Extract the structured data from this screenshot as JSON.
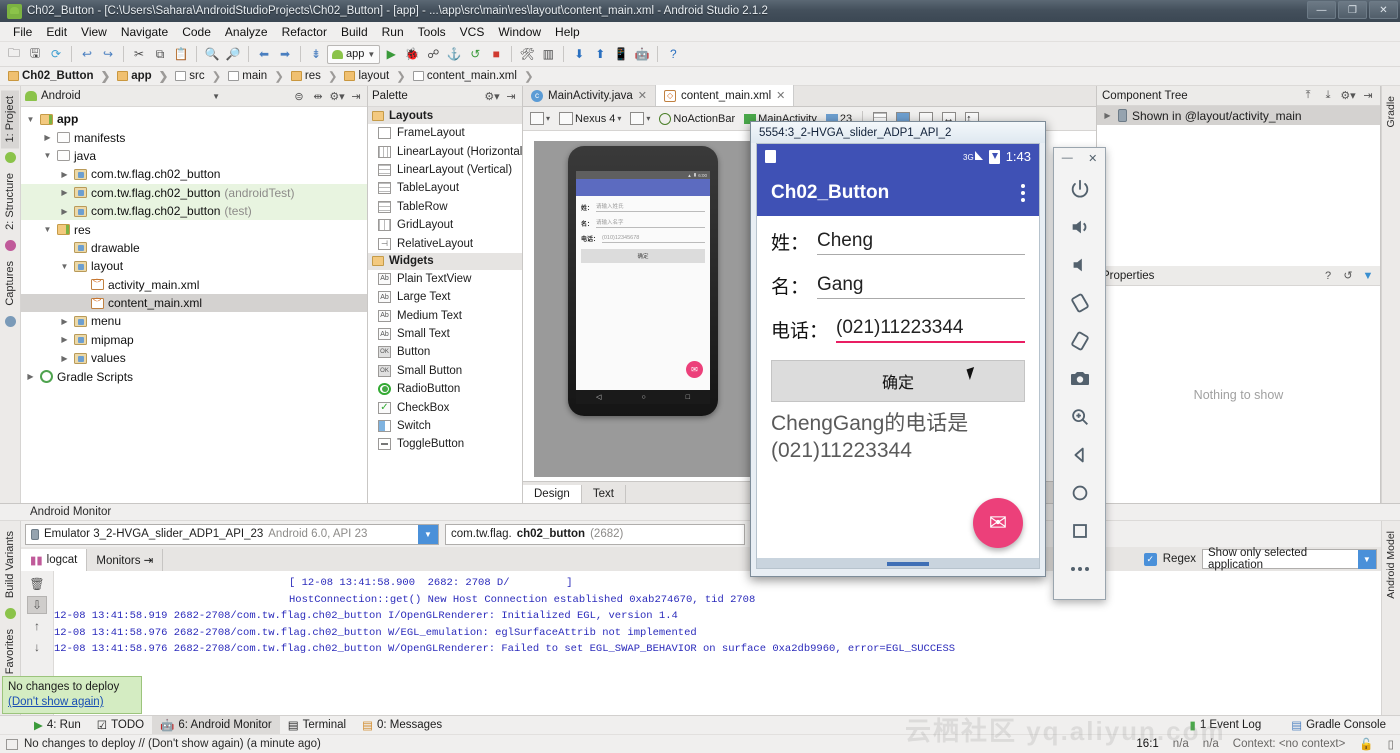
{
  "window": {
    "title": "Ch02_Button - [C:\\Users\\Sahara\\AndroidStudioProjects\\Ch02_Button] - [app] - ...\\app\\src\\main\\res\\layout\\content_main.xml - Android Studio 2.1.2",
    "minimize": "—",
    "maximize": "❐",
    "close": "✕"
  },
  "menu": [
    "File",
    "Edit",
    "View",
    "Navigate",
    "Code",
    "Analyze",
    "Refactor",
    "Build",
    "Run",
    "Tools",
    "VCS",
    "Window",
    "Help"
  ],
  "toolbar": {
    "app_label": "app"
  },
  "breadcrumb": [
    {
      "label": "Ch02_Button",
      "type": "folder",
      "bold": true
    },
    {
      "label": "app",
      "type": "folderb",
      "bold": true
    },
    {
      "label": "src",
      "type": "folderw",
      "bold": false
    },
    {
      "label": "main",
      "type": "folderw",
      "bold": false
    },
    {
      "label": "res",
      "type": "folderb",
      "bold": false
    },
    {
      "label": "layout",
      "type": "pkg",
      "bold": false
    },
    {
      "label": "content_main.xml",
      "type": "xml",
      "bold": false
    }
  ],
  "left_rail": [
    "1: Project",
    "2: Structure",
    "Captures"
  ],
  "left_rail_bottom": [
    "Build Variants",
    "Favorites"
  ],
  "right_rail": [
    "Gradle",
    "Android Model"
  ],
  "project": {
    "header_label": "Android",
    "tree": [
      {
        "indent": 0,
        "arrow": "▼",
        "icon": "folderb",
        "label": "app",
        "bold": true,
        "dim": "",
        "state": "none"
      },
      {
        "indent": 1,
        "arrow": "▶",
        "icon": "folderw",
        "label": "manifests",
        "bold": false,
        "dim": "",
        "state": "none"
      },
      {
        "indent": 1,
        "arrow": "▼",
        "icon": "folderw",
        "label": "java",
        "bold": false,
        "dim": "",
        "state": "none"
      },
      {
        "indent": 2,
        "arrow": "▶",
        "icon": "pkg",
        "label": "com.tw.flag.ch02_button",
        "bold": false,
        "dim": "",
        "state": "none"
      },
      {
        "indent": 2,
        "arrow": "▶",
        "icon": "pkg",
        "label": "com.tw.flag.ch02_button",
        "bold": false,
        "dim": "(androidTest)",
        "state": "test"
      },
      {
        "indent": 2,
        "arrow": "▶",
        "icon": "pkg",
        "label": "com.tw.flag.ch02_button",
        "bold": false,
        "dim": "(test)",
        "state": "test"
      },
      {
        "indent": 1,
        "arrow": "▼",
        "icon": "folderb",
        "label": "res",
        "bold": false,
        "dim": "",
        "state": "none"
      },
      {
        "indent": 2,
        "arrow": "",
        "icon": "pkg",
        "label": "drawable",
        "bold": false,
        "dim": "",
        "state": "none"
      },
      {
        "indent": 2,
        "arrow": "▼",
        "icon": "pkg",
        "label": "layout",
        "bold": false,
        "dim": "",
        "state": "none"
      },
      {
        "indent": 3,
        "arrow": "",
        "icon": "xml",
        "label": "activity_main.xml",
        "bold": false,
        "dim": "",
        "state": "none"
      },
      {
        "indent": 3,
        "arrow": "",
        "icon": "xml",
        "label": "content_main.xml",
        "bold": false,
        "dim": "",
        "state": "selected"
      },
      {
        "indent": 2,
        "arrow": "▶",
        "icon": "pkg",
        "label": "menu",
        "bold": false,
        "dim": "",
        "state": "none"
      },
      {
        "indent": 2,
        "arrow": "▶",
        "icon": "pkg",
        "label": "mipmap",
        "bold": false,
        "dim": "",
        "state": "none"
      },
      {
        "indent": 2,
        "arrow": "▶",
        "icon": "pkg",
        "label": "values",
        "bold": false,
        "dim": "",
        "state": "none"
      },
      {
        "indent": 0,
        "arrow": "▶",
        "icon": "gradle",
        "label": "Gradle Scripts",
        "bold": false,
        "dim": "",
        "state": "none"
      }
    ]
  },
  "palette": {
    "title": "Palette",
    "groups": [
      {
        "name": "Layouts",
        "items": [
          {
            "label": "FrameLayout",
            "icon": "frame"
          },
          {
            "label": "LinearLayout (Horizontal)",
            "icon": "linh"
          },
          {
            "label": "LinearLayout (Vertical)",
            "icon": "linv"
          },
          {
            "label": "TableLayout",
            "icon": "tbl"
          },
          {
            "label": "TableRow",
            "icon": "tbl"
          },
          {
            "label": "GridLayout",
            "icon": "grid"
          },
          {
            "label": "RelativeLayout",
            "icon": "rel"
          }
        ]
      },
      {
        "name": "Widgets",
        "items": [
          {
            "label": "Plain TextView",
            "icon": "ab"
          },
          {
            "label": "Large Text",
            "icon": "ab"
          },
          {
            "label": "Medium Text",
            "icon": "ab"
          },
          {
            "label": "Small Text",
            "icon": "ab"
          },
          {
            "label": "Button",
            "icon": "ok"
          },
          {
            "label": "Small Button",
            "icon": "ok"
          },
          {
            "label": "RadioButton",
            "icon": "radio"
          },
          {
            "label": "CheckBox",
            "icon": "check"
          },
          {
            "label": "Switch",
            "icon": "switch"
          },
          {
            "label": "ToggleButton",
            "icon": "toggle"
          }
        ]
      }
    ]
  },
  "editor_tabs": [
    {
      "label": "MainActivity.java",
      "icon": "java",
      "active": false
    },
    {
      "label": "content_main.xml",
      "icon": "xml",
      "active": true
    }
  ],
  "design_toolbar": {
    "device": "Nexus 4",
    "theme": "NoActionBar",
    "activity": "MainActivity",
    "api": "23"
  },
  "design_preview": {
    "rows": [
      {
        "label": "姓：",
        "placeholder": "请输入姓氏"
      },
      {
        "label": "名：",
        "placeholder": "请输入名字"
      },
      {
        "label": "电话：",
        "placeholder": "(010)12345678"
      }
    ],
    "button": "确定",
    "status_time": "6:00"
  },
  "design_tabs": [
    {
      "label": "Design",
      "active": true
    },
    {
      "label": "Text",
      "active": false
    }
  ],
  "component_tree": {
    "title": "Component Tree",
    "root_item": "Shown in @layout/activity_main"
  },
  "properties": {
    "title": "Properties",
    "empty_text": "Nothing to show"
  },
  "monitor": {
    "title": "Android Monitor",
    "device": "Emulator 3_2-HVGA_slider_ADP1_API_23",
    "device_detail": "Android 6.0, API 23",
    "process_prefix": "com.tw.flag.",
    "process_bold": "ch02_button",
    "process_pid": "(2682)",
    "tabs": [
      {
        "label": "logcat",
        "active": true
      },
      {
        "label": "Monitors  ⇥",
        "active": false
      }
    ],
    "regex_label": "Regex",
    "filter_value": "Show only selected application",
    "log_lines": [
      {
        "text": "[ 12-08 13:41:58.900  2682: 2708 D/         ]",
        "indent": true
      },
      {
        "text": "HostConnection::get() New Host Connection established 0xab274670, tid 2708",
        "indent": true
      },
      {
        "text": "12-08 13:41:58.919 2682-2708/com.tw.flag.ch02_button I/OpenGLRenderer: Initialized EGL, version 1.4",
        "indent": false
      },
      {
        "text": "12-08 13:41:58.976 2682-2708/com.tw.flag.ch02_button W/EGL_emulation: eglSurfaceAttrib not implemented",
        "indent": false
      },
      {
        "text": "12-08 13:41:58.976 2682-2708/com.tw.flag.ch02_button W/OpenGLRenderer: Failed to set EGL_SWAP_BEHAVIOR on surface 0xa2db9960, error=EGL_SUCCESS",
        "indent": false
      }
    ]
  },
  "tooltip": {
    "line1": "No changes to deploy",
    "link": "(Don't show again)"
  },
  "status_tabs": [
    {
      "label": "4: Run",
      "icon": "run",
      "sel": false
    },
    {
      "label": "TODO",
      "icon": "todo",
      "sel": false
    },
    {
      "label": "6: Android Monitor",
      "icon": "android",
      "sel": true
    },
    {
      "label": "Terminal",
      "icon": "terminal",
      "sel": false
    },
    {
      "label": "0: Messages",
      "icon": "messages",
      "sel": false
    }
  ],
  "status_right_tabs": [
    {
      "label": "1 Event Log",
      "icon": "event"
    },
    {
      "label": "Gradle Console",
      "icon": "gradle"
    }
  ],
  "statusbar": {
    "message": "No changes to deploy // (Don't show again) (a minute ago)",
    "caret": "16:1",
    "enc": "n/a",
    "lineend": "n/a",
    "context": "Context: <no context>"
  },
  "emulator": {
    "title": "5554:3_2-HVGA_slider_ADP1_API_2",
    "status_time": "1:43",
    "status_net": "3G",
    "app_title": "Ch02_Button",
    "fields": [
      {
        "label": "姓：",
        "value": "Cheng",
        "highlight": false
      },
      {
        "label": "名：",
        "value": "Gang",
        "highlight": false
      },
      {
        "label": "电话：",
        "value": "(021)11223344",
        "highlight": true
      }
    ],
    "button": "确定",
    "result_line1": "ChengGang的电话是",
    "result_line2": "(021)11223344",
    "fab_icon": "✉"
  },
  "emulator_toolbar": {
    "minimize": "—",
    "close": "✕",
    "buttons": [
      "power-icon",
      "volume-up-icon",
      "volume-down-icon",
      "rotate-left-icon",
      "rotate-right-icon",
      "screenshot-icon",
      "zoom-icon",
      "back-icon",
      "home-icon",
      "overview-icon",
      "more-icon"
    ]
  },
  "watermark": "云栖社区 yq.aliyun.com",
  "colors": {
    "accent": "#3f51b5",
    "fab": "#ec407a",
    "select": "#4a90d9"
  }
}
